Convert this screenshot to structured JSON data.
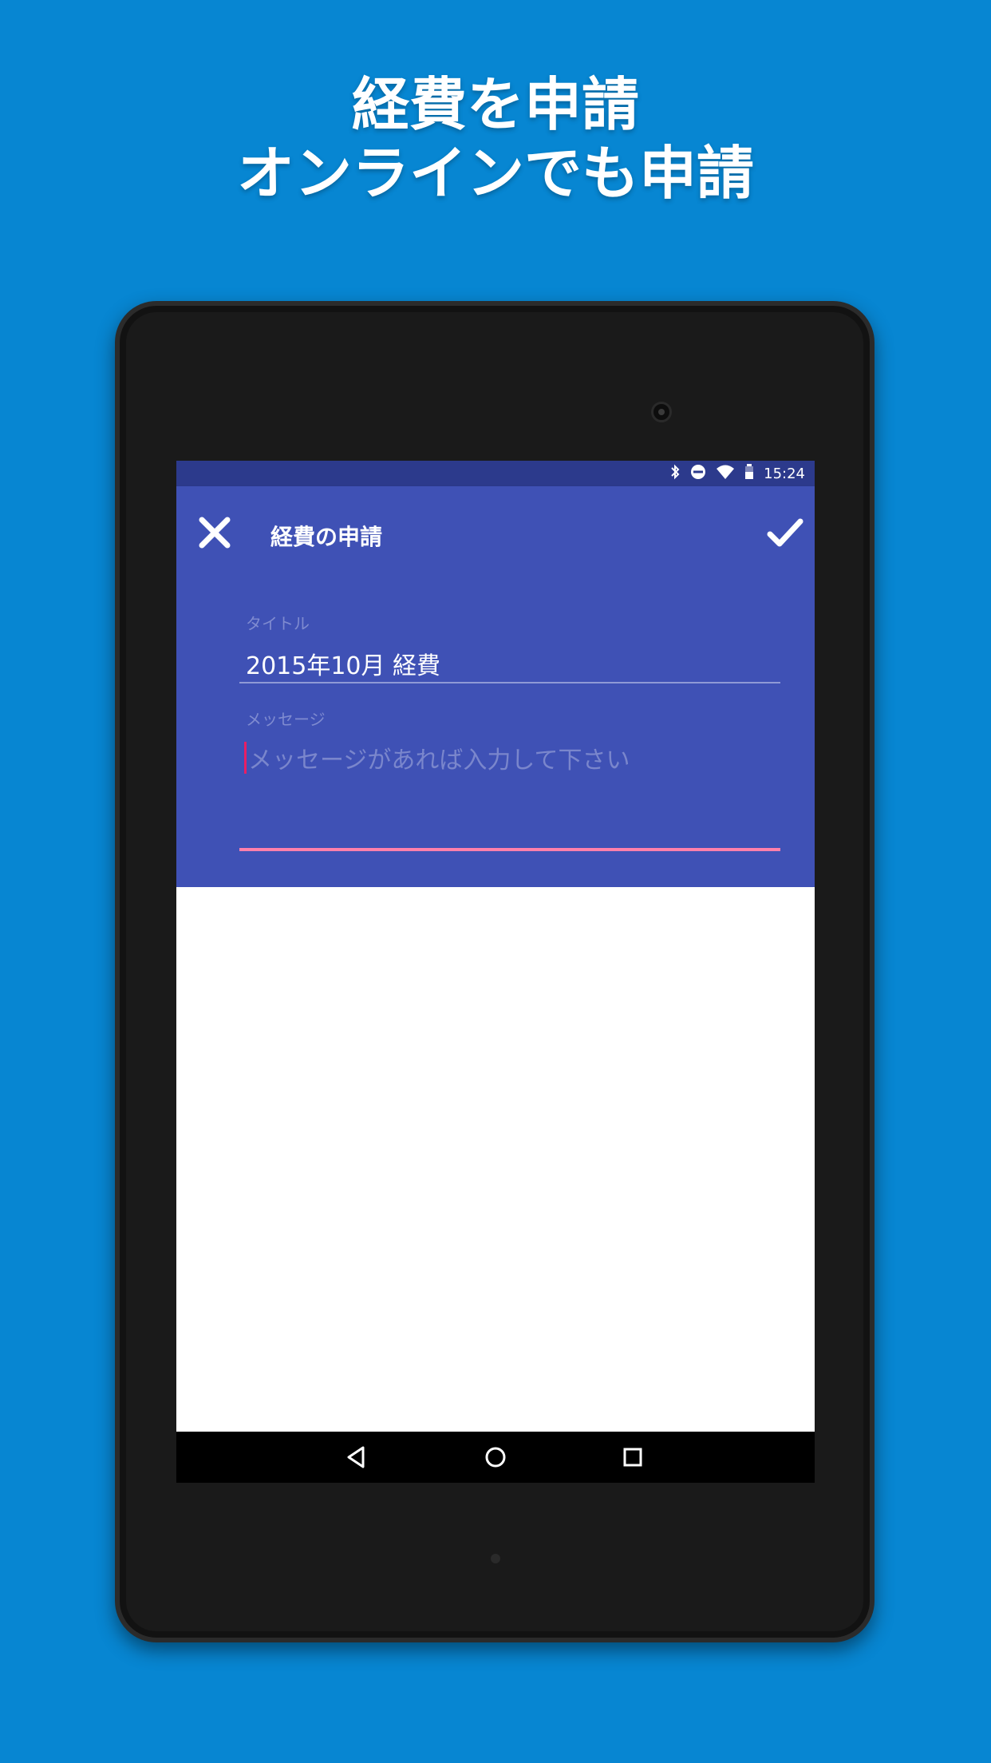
{
  "promo": {
    "line1": "経費を申請",
    "line2": "オンラインでも申請"
  },
  "statusbar": {
    "icons": [
      "bluetooth-icon",
      "do-not-disturb-icon",
      "wifi-icon",
      "battery-icon"
    ],
    "time": "15:24"
  },
  "appbar": {
    "title": "経費の申請",
    "close_icon": "close-icon",
    "confirm_icon": "check-icon",
    "color": "#3f51b5"
  },
  "form": {
    "title_label": "タイトル",
    "title_value": "2015年10月 経費",
    "message_label": "メッセージ",
    "message_placeholder": "メッセージがあれば入力して下さい",
    "message_value": ""
  },
  "navbar": {
    "buttons": [
      "back-icon",
      "home-icon",
      "recents-icon"
    ]
  },
  "colors": {
    "background": "#0786d2",
    "accent": "#ff80ab",
    "statusbar": "#2c3a8c"
  }
}
